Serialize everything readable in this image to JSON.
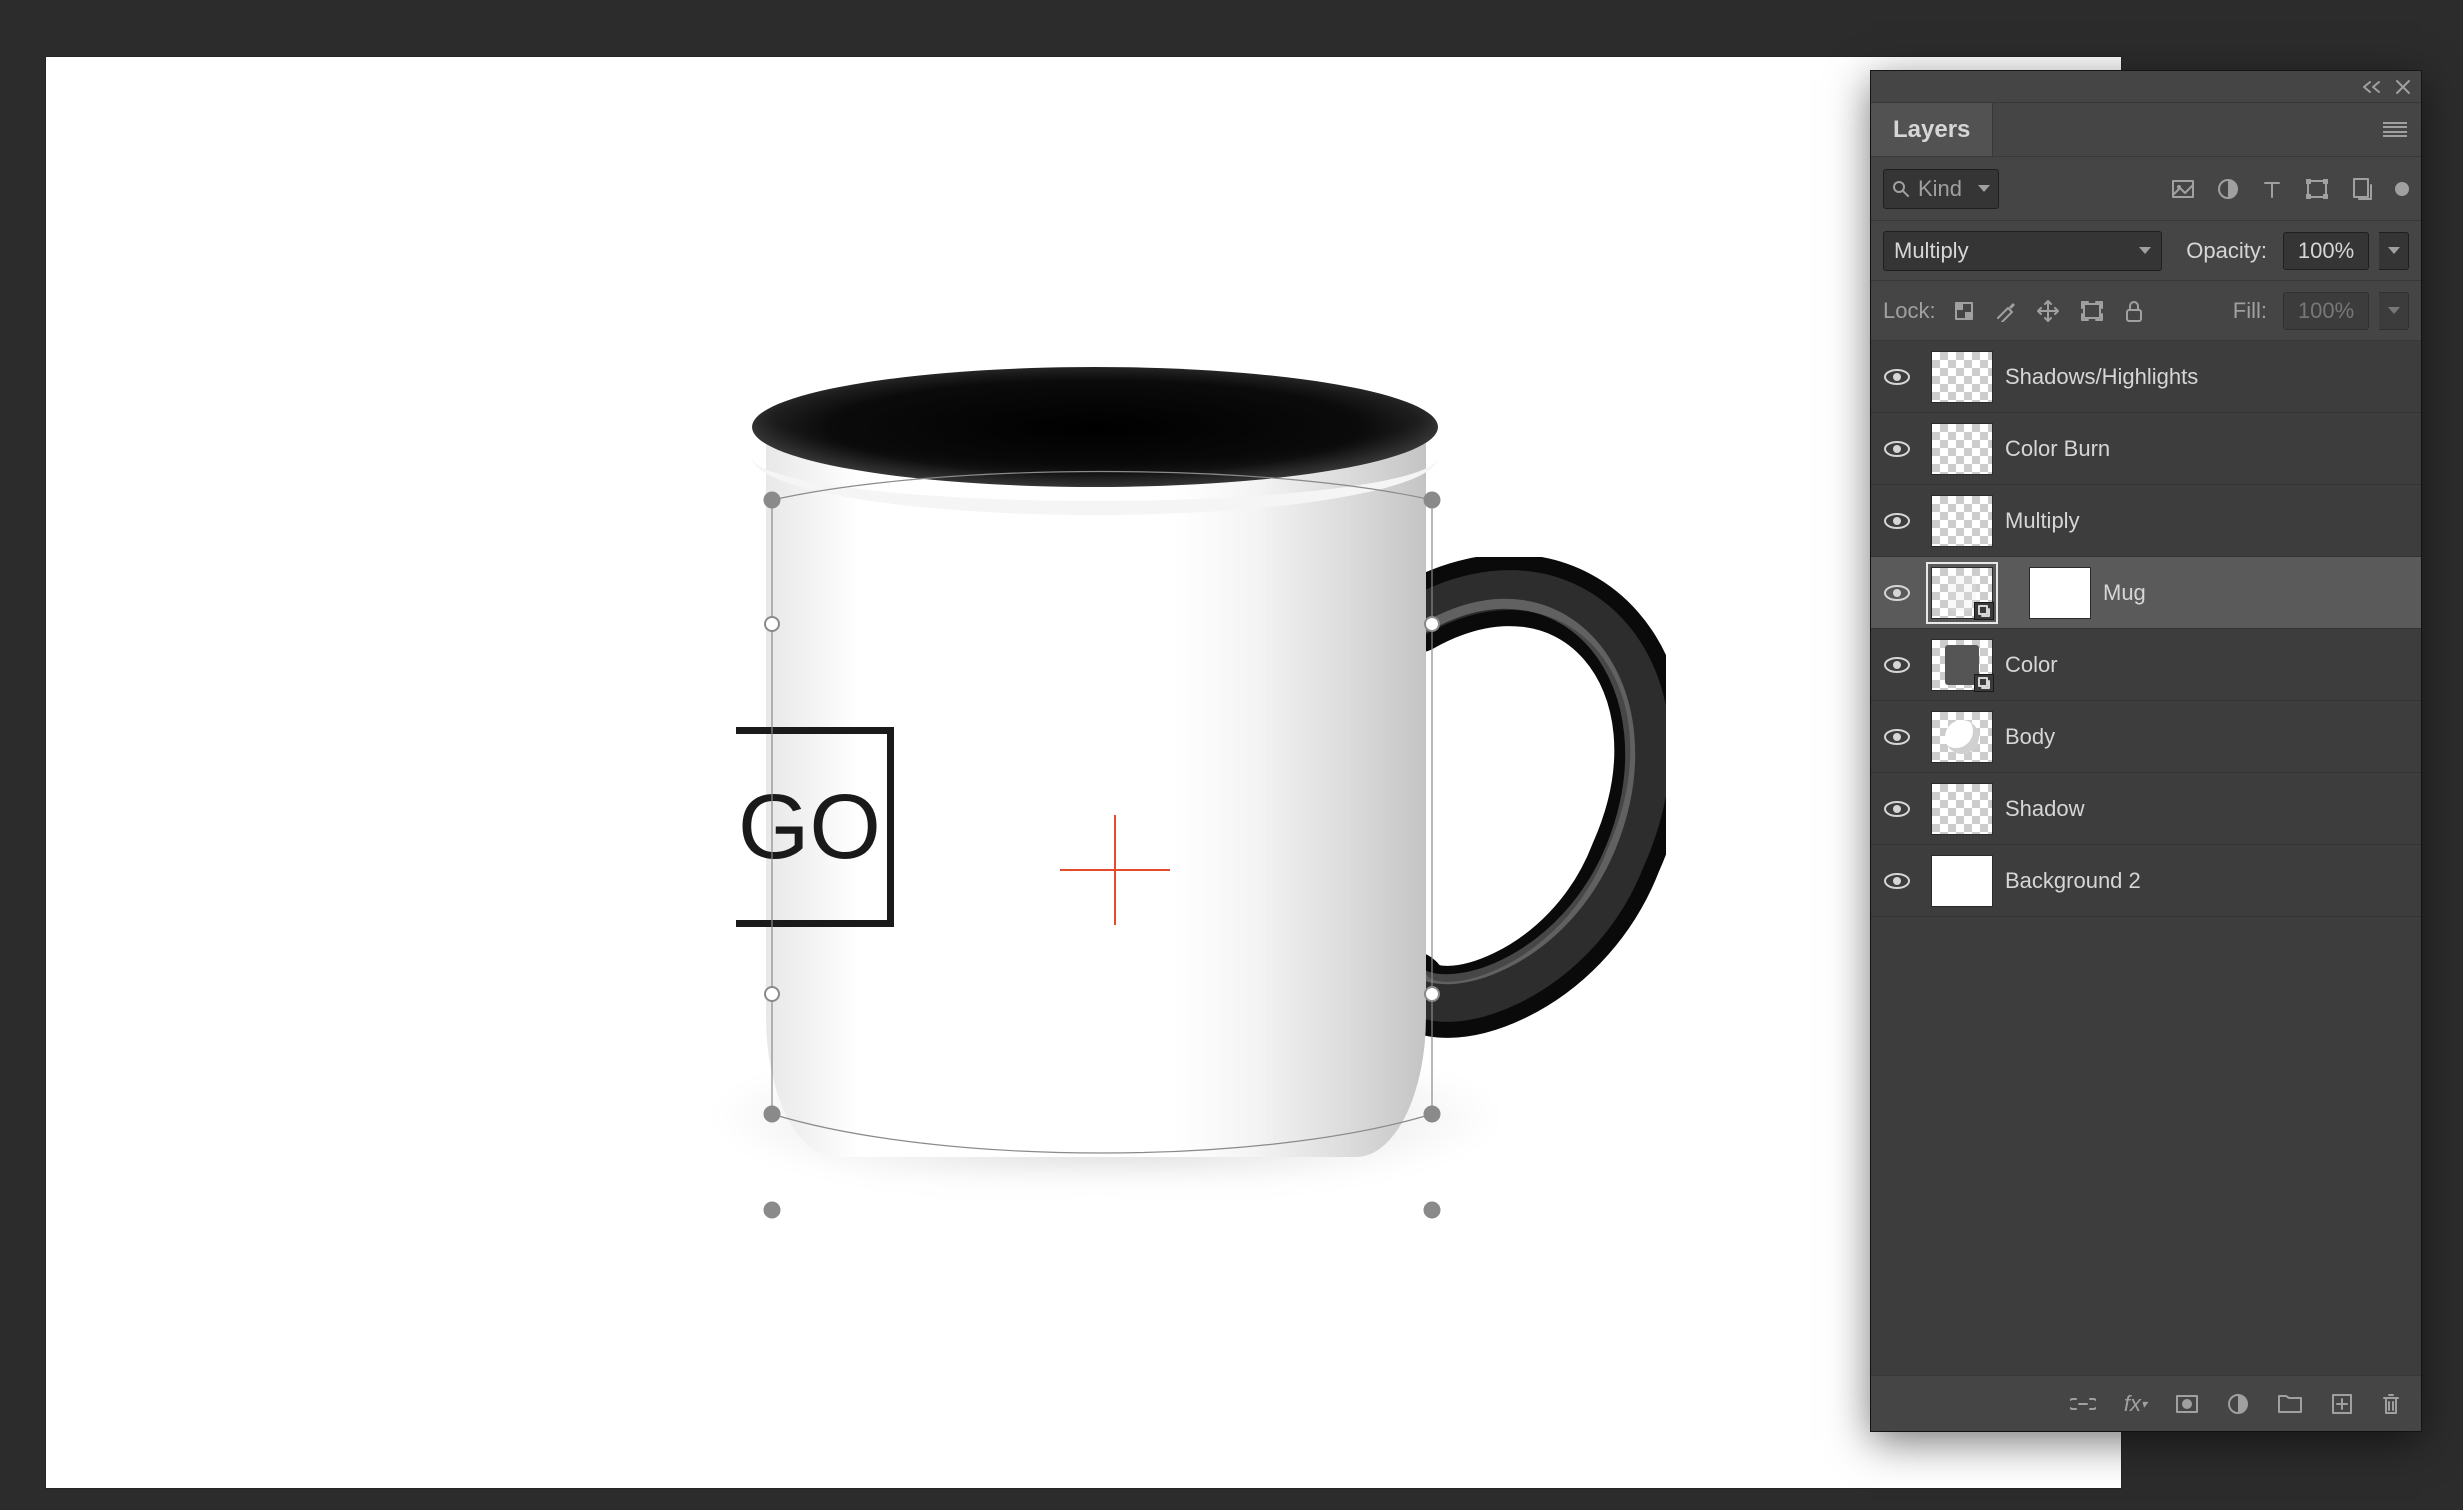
{
  "canvas": {
    "logo_text": "OGO"
  },
  "panel": {
    "tab_label": "Layers",
    "search_placeholder": "Kind",
    "blend_mode": "Multiply",
    "opacity_label": "Opacity:",
    "opacity_value": "100%",
    "lock_label": "Lock:",
    "fill_label": "Fill:",
    "fill_value": "100%"
  },
  "layers": [
    {
      "name": "Shadows/Highlights",
      "visible": true,
      "selected": false,
      "thumb": "checker",
      "mask": false
    },
    {
      "name": "Color Burn",
      "visible": true,
      "selected": false,
      "thumb": "checker",
      "mask": false
    },
    {
      "name": "Multiply",
      "visible": true,
      "selected": false,
      "thumb": "checker",
      "mask": false
    },
    {
      "name": "Mug",
      "visible": true,
      "selected": true,
      "thumb": "smart",
      "mask": true
    },
    {
      "name": "Color",
      "visible": true,
      "selected": false,
      "thumb": "smart-dark",
      "mask": false
    },
    {
      "name": "Body",
      "visible": true,
      "selected": false,
      "thumb": "blob",
      "mask": false
    },
    {
      "name": "Shadow",
      "visible": true,
      "selected": false,
      "thumb": "checker",
      "mask": false
    },
    {
      "name": "Background 2",
      "visible": true,
      "selected": false,
      "thumb": "white",
      "mask": false
    }
  ]
}
